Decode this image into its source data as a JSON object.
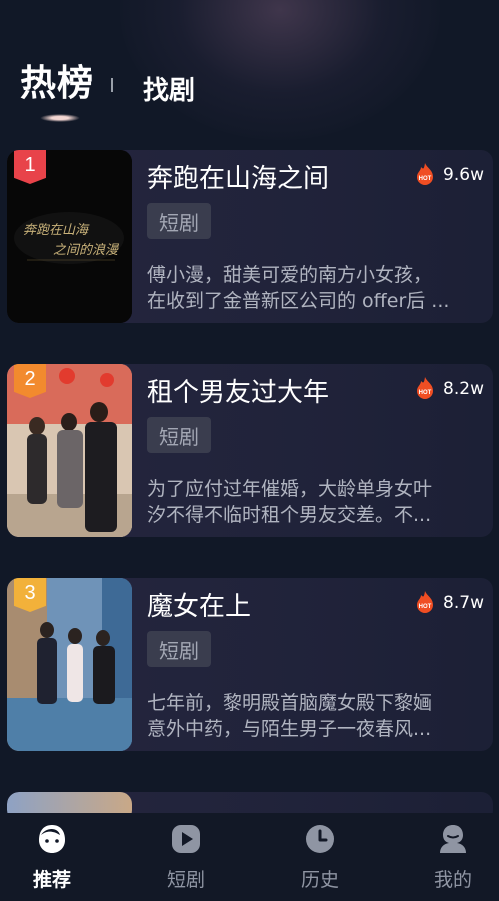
{
  "header": {
    "tab_active": "热榜",
    "tab_other": "找剧"
  },
  "list": [
    {
      "rank": "1",
      "rank_color": "#e8434a",
      "title": "奔跑在山海之间",
      "views": "9.6w",
      "tag": "短剧",
      "desc_line1": "傅小漫，甜美可爱的南方小女孩，",
      "desc_line2": "在收到了金普新区公司的 offer后 ...",
      "poster_text_line1": "奔跑在山海",
      "poster_text_line2": "之间的浪漫"
    },
    {
      "rank": "2",
      "rank_color": "#f28a2e",
      "title": "租个男友过大年",
      "views": "8.2w",
      "tag": "短剧",
      "desc_line1": "为了应付过年催婚，大龄单身女叶",
      "desc_line2": "汐不得不临时租个男友交差。不..."
    },
    {
      "rank": "3",
      "rank_color": "#f2b13a",
      "title": "魔女在上",
      "views": "8.7w",
      "tag": "短剧",
      "desc_line1": "七年前，黎明殿首脑魔女殿下黎婳",
      "desc_line2": "意外中药，与陌生男子一夜春风..."
    }
  ],
  "hot_badge_text": "HOT",
  "nav": [
    {
      "label": "推荐",
      "icon": "home-face-icon",
      "active": true
    },
    {
      "label": "短剧",
      "icon": "play-icon",
      "active": false
    },
    {
      "label": "历史",
      "icon": "clock-icon",
      "active": false
    },
    {
      "label": "我的",
      "icon": "profile-icon",
      "active": false
    }
  ]
}
